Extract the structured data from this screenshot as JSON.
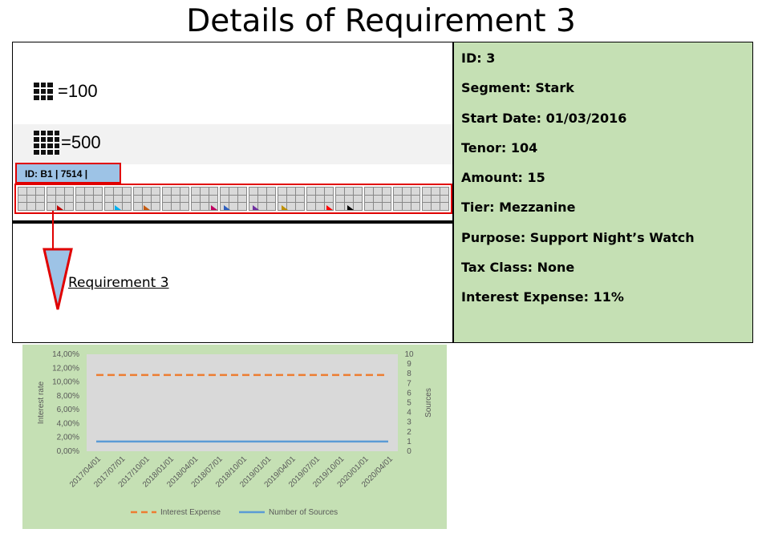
{
  "title": "Details of Requirement 3",
  "legend": {
    "small_label": "=100",
    "large_label": "=500"
  },
  "id_box": "ID: B1 | 7514 |",
  "requirement_label": "Requirement 3",
  "strip_markers": [
    {
      "color": "#c00000"
    },
    {
      "color": "#00b0f0"
    },
    {
      "color": "#c55a11"
    },
    {
      "color": "#c00060"
    },
    {
      "color": "#2e5fbf"
    },
    {
      "color": "#7030a0"
    },
    {
      "color": "#bf9000"
    },
    {
      "color": "#ff0000"
    },
    {
      "color": "#000000"
    }
  ],
  "details": [
    "ID: 3",
    "Segment: Stark",
    "Start Date: 01/03/2016",
    "Tenor: 104",
    "Amount: 15",
    "Tier: Mezzanine",
    "Purpose: Support Night’s Watch",
    "Tax Class: None",
    "Interest Expense: 11%"
  ],
  "chart_data": {
    "type": "line",
    "x": [
      "2017/04/01",
      "2017/07/01",
      "2017/10/01",
      "2018/01/01",
      "2018/04/01",
      "2018/07/01",
      "2018/10/01",
      "2019/01/01",
      "2019/04/01",
      "2019/07/01",
      "2019/10/01",
      "2020/01/01",
      "2020/04/01"
    ],
    "ylabel": "Interest rate",
    "y2label": "Sources",
    "ylim": [
      0,
      14
    ],
    "y_ticks": [
      "0,00%",
      "2,00%",
      "4,00%",
      "6,00%",
      "8,00%",
      "10,00%",
      "12,00%",
      "14,00%"
    ],
    "y2lim": [
      0,
      10
    ],
    "y2_ticks": [
      "0",
      "1",
      "2",
      "3",
      "4",
      "5",
      "6",
      "7",
      "8",
      "9",
      "10"
    ],
    "series": [
      {
        "name": "Interest Expense",
        "axis": "left",
        "values": [
          11,
          11,
          11,
          11,
          11,
          11,
          11,
          11,
          11,
          11,
          11,
          11,
          11
        ],
        "color": "#ed7d31",
        "dashed": true
      },
      {
        "name": "Number of Sources",
        "axis": "right",
        "values": [
          1,
          1,
          1,
          1,
          1,
          1,
          1,
          1,
          1,
          1,
          1,
          1,
          1
        ],
        "color": "#5b9bd5",
        "dashed": false
      }
    ],
    "grid": false,
    "legend_position": "bottom"
  }
}
